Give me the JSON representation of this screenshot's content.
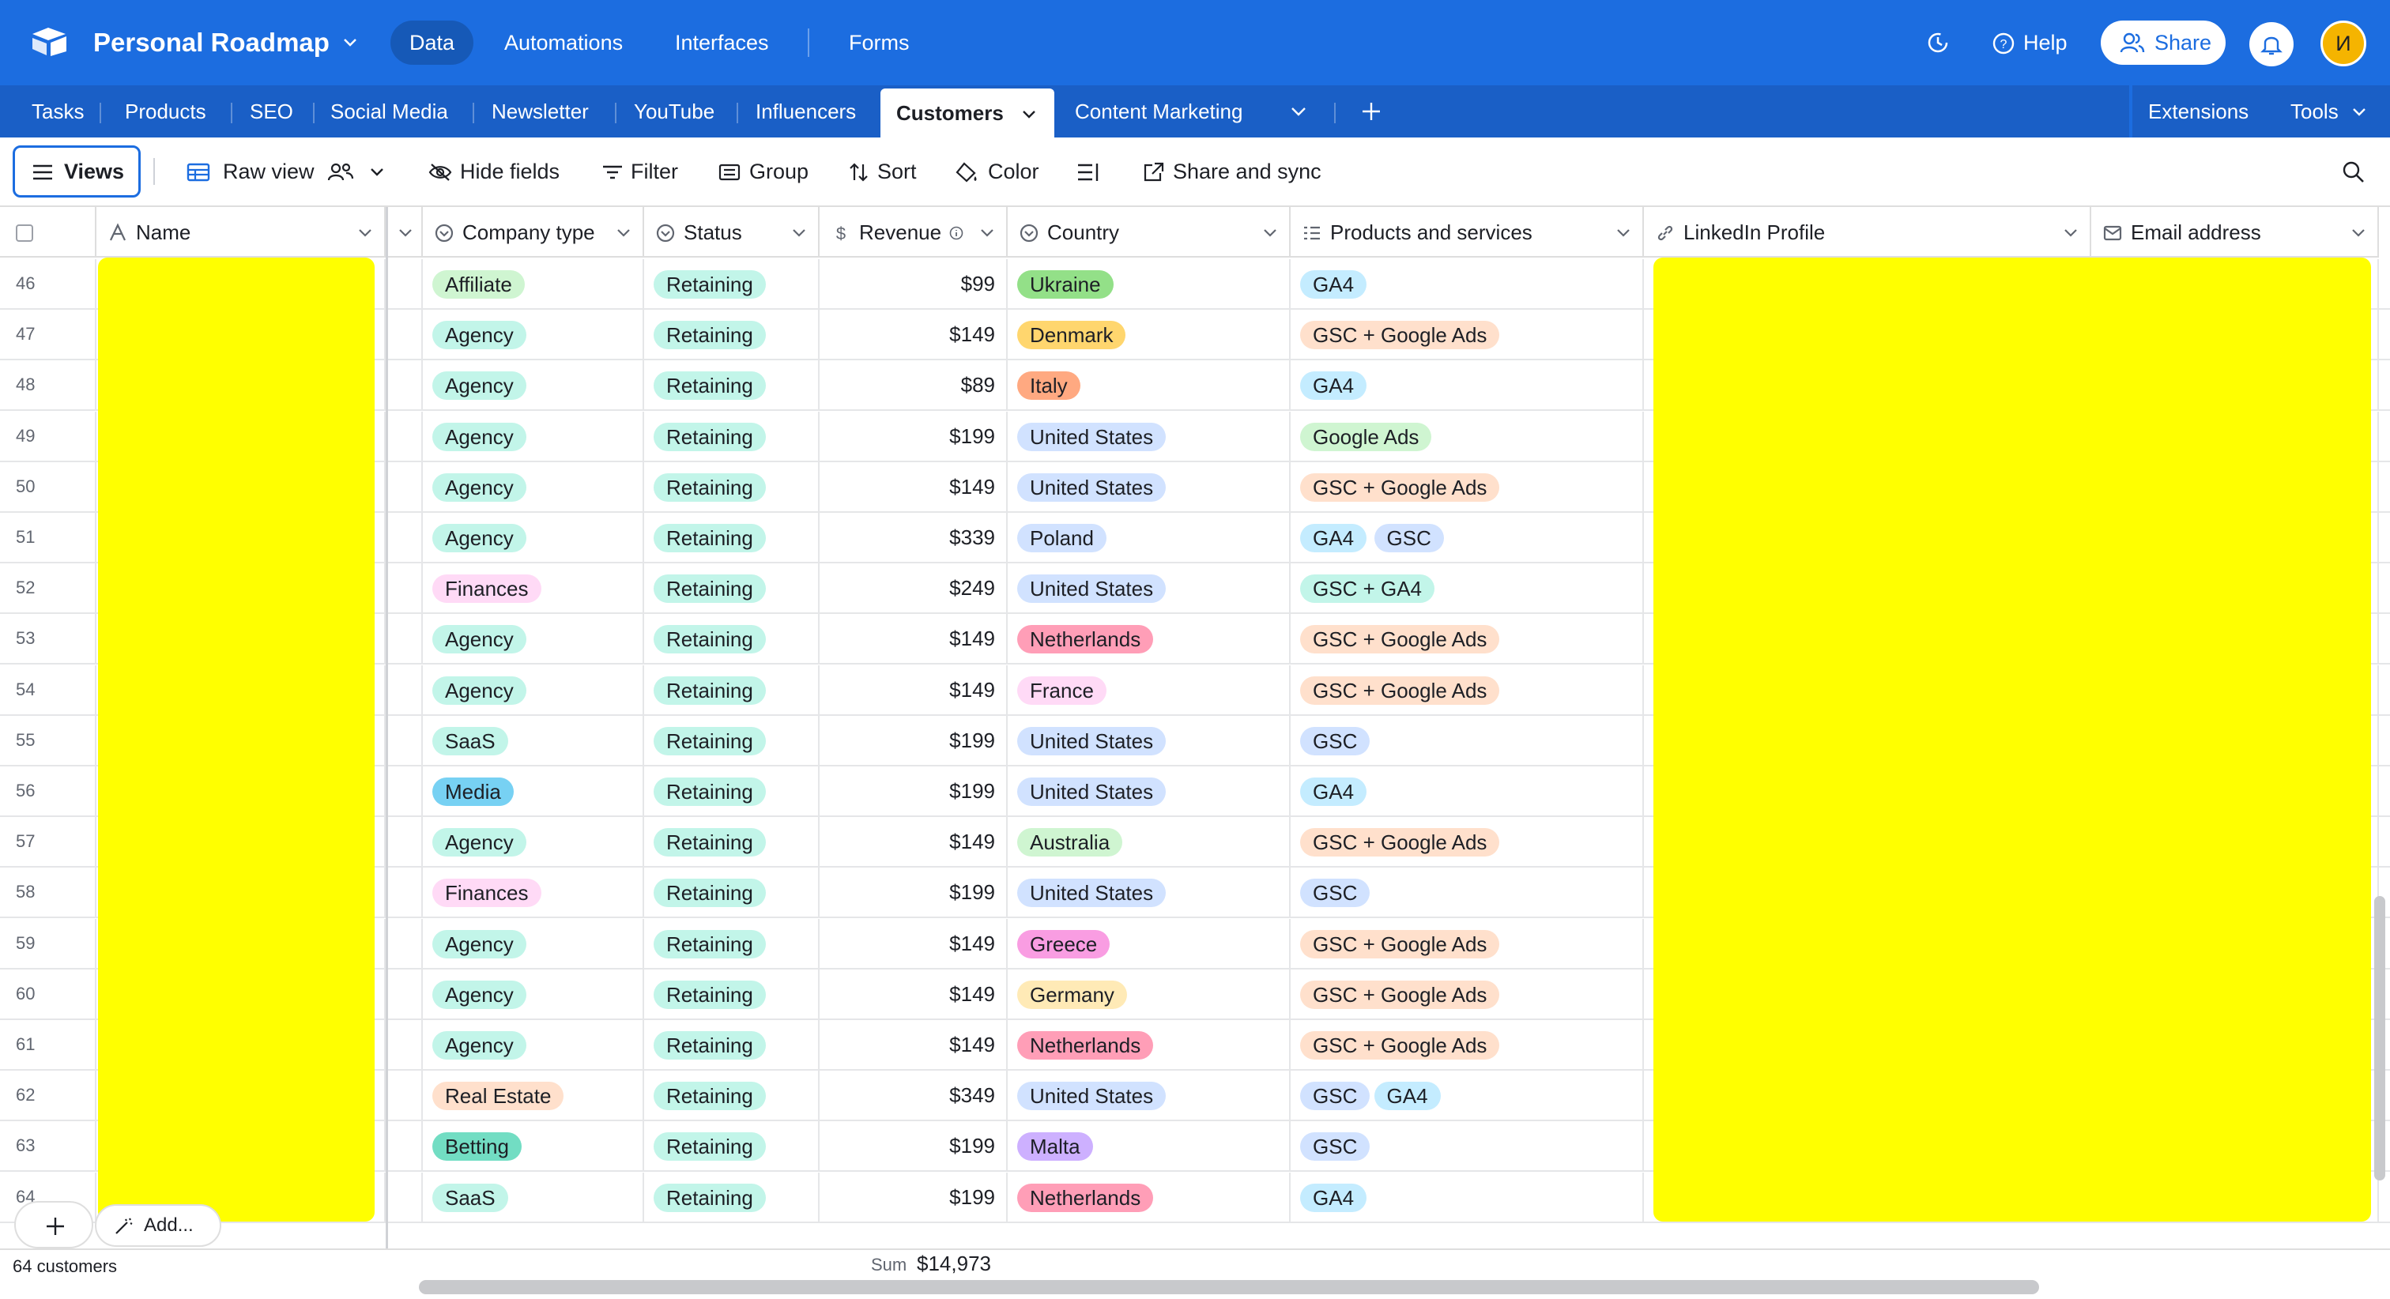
{
  "topbar": {
    "base_title": "Personal Roadmap",
    "nav": [
      "Data",
      "Automations",
      "Interfaces",
      "Forms"
    ],
    "active_nav": "Data",
    "help_label": "Help",
    "share_label": "Share",
    "avatar_initial": "И",
    "colors": {
      "bar": "#1c6de0",
      "avatar": "#f5b400"
    }
  },
  "tabs": {
    "items": [
      "Tasks",
      "Products",
      "SEO",
      "Social Media",
      "Newsletter",
      "YouTube",
      "Influencers",
      "Customers",
      "Content Marketing"
    ],
    "active": "Customers",
    "extensions_label": "Extensions",
    "tools_label": "Tools"
  },
  "viewbar": {
    "views_label": "Views",
    "view_name": "Raw view",
    "hide_fields": "Hide fields",
    "filter": "Filter",
    "group": "Group",
    "sort": "Sort",
    "color": "Color",
    "share_sync": "Share and sync"
  },
  "columns": {
    "name": "Name",
    "company_type": "Company type",
    "status": "Status",
    "revenue": "Revenue",
    "country": "Country",
    "products": "Products and services",
    "linkedin": "LinkedIn Profile",
    "email": "Email address"
  },
  "rows": [
    {
      "n": "46",
      "type": "Affiliate",
      "status": "Retaining",
      "revenue": "$99",
      "country": "Ukraine",
      "products": [
        "GA4"
      ]
    },
    {
      "n": "47",
      "type": "Agency",
      "status": "Retaining",
      "revenue": "$149",
      "country": "Denmark",
      "products": [
        "GSC + Google Ads"
      ]
    },
    {
      "n": "48",
      "type": "Agency",
      "status": "Retaining",
      "revenue": "$89",
      "country": "Italy",
      "products": [
        "GA4"
      ]
    },
    {
      "n": "49",
      "type": "Agency",
      "status": "Retaining",
      "revenue": "$199",
      "country": "United States",
      "products": [
        "Google Ads"
      ]
    },
    {
      "n": "50",
      "type": "Agency",
      "status": "Retaining",
      "revenue": "$149",
      "country": "United States",
      "products": [
        "GSC + Google Ads"
      ]
    },
    {
      "n": "51",
      "type": "Agency",
      "status": "Retaining",
      "revenue": "$339",
      "country": "Poland",
      "products": [
        "GA4",
        "GSC"
      ]
    },
    {
      "n": "52",
      "type": "Finances",
      "status": "Retaining",
      "revenue": "$249",
      "country": "United States",
      "products": [
        "GSC + GA4"
      ]
    },
    {
      "n": "53",
      "type": "Agency",
      "status": "Retaining",
      "revenue": "$149",
      "country": "Netherlands",
      "products": [
        "GSC + Google Ads"
      ]
    },
    {
      "n": "54",
      "type": "Agency",
      "status": "Retaining",
      "revenue": "$149",
      "country": "France",
      "products": [
        "GSC + Google Ads"
      ]
    },
    {
      "n": "55",
      "type": "SaaS",
      "status": "Retaining",
      "revenue": "$199",
      "country": "United States",
      "products": [
        "GSC"
      ]
    },
    {
      "n": "56",
      "type": "Media",
      "status": "Retaining",
      "revenue": "$199",
      "country": "United States",
      "products": [
        "GA4"
      ]
    },
    {
      "n": "57",
      "type": "Agency",
      "status": "Retaining",
      "revenue": "$149",
      "country": "Australia",
      "products": [
        "GSC + Google Ads"
      ]
    },
    {
      "n": "58",
      "type": "Finances",
      "status": "Retaining",
      "revenue": "$199",
      "country": "United States",
      "products": [
        "GSC"
      ]
    },
    {
      "n": "59",
      "type": "Agency",
      "status": "Retaining",
      "revenue": "$149",
      "country": "Greece",
      "products": [
        "GSC + Google Ads"
      ]
    },
    {
      "n": "60",
      "type": "Agency",
      "status": "Retaining",
      "revenue": "$149",
      "country": "Germany",
      "products": [
        "GSC + Google Ads"
      ]
    },
    {
      "n": "61",
      "type": "Agency",
      "status": "Retaining",
      "revenue": "$149",
      "country": "Netherlands",
      "products": [
        "GSC + Google Ads"
      ]
    },
    {
      "n": "62",
      "type": "Real Estate",
      "status": "Retaining",
      "revenue": "$349",
      "country": "United States",
      "products": [
        "GSC",
        "GA4"
      ]
    },
    {
      "n": "63",
      "type": "Betting",
      "status": "Retaining",
      "revenue": "$199",
      "country": "Malta",
      "products": [
        "GSC"
      ]
    },
    {
      "n": "64",
      "type": "SaaS",
      "status": "Retaining",
      "revenue": "$199",
      "country": "Netherlands",
      "products": [
        "GA4"
      ]
    }
  ],
  "pill_colors": {
    "type": {
      "Affiliate": "#cff5d1",
      "Agency": "#c2f5e9",
      "Finances": "#ffdaf6",
      "SaaS": "#c2f5e9",
      "Media": "#77d1f3",
      "Real Estate": "#ffe0cc",
      "Betting": "#72ddc3"
    },
    "status": {
      "Retaining": "#c2f5e9"
    },
    "country": {
      "Ukraine": "#93e088",
      "Denmark": "#ffd66e",
      "Italy": "#ffa981",
      "United States": "#d1e2ff",
      "Poland": "#d1e2ff",
      "Netherlands": "#ff9eb7",
      "France": "#ffdaf6",
      "Australia": "#cff5d1",
      "Greece": "#f99de2",
      "Germany": "#ffeab6",
      "Malta": "#cdb0ff"
    },
    "products": {
      "GA4": "#c4ecff",
      "GSC": "#d1e2ff",
      "GSC + Google Ads": "#ffe0cc",
      "Google Ads": "#cff5d1",
      "GSC + GA4": "#c2f5e9"
    }
  },
  "footer": {
    "add_label": "Add...",
    "count_label": "64 customers",
    "sum_label": "Sum",
    "sum_value": "$14,973"
  }
}
